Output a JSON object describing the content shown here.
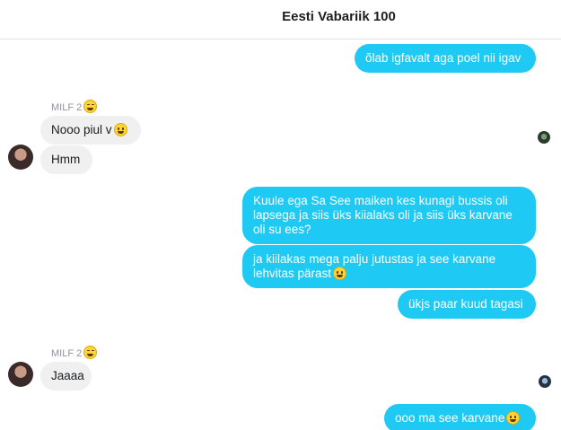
{
  "header": {
    "title": "Eesti Vabariik 100"
  },
  "messages": {
    "m1": "õlab igfavalt aga poel nii igav",
    "sender1": "MILF 2",
    "m2": "Nooo piul v",
    "m3": "Hmm",
    "m4": "Kuule ega Sa See maiken kes kunagi bussis oli lapsega ja siis üks kiialaks oli ja siis üks karvane oli su ees?",
    "m5": "ja kiilakas mega palju jutustas ja see karvane lehvitas pärast",
    "m6": "ükjs paar kuud tagasi",
    "sender2": "MILF 2",
    "m7": "Jaaaa",
    "m8": "ooo ma see karvane"
  },
  "icons": {
    "sender_emoji": "face-with-tears-of-joy-icon",
    "message_emoji": "grinning-face-icon",
    "avatar": "contact-avatar",
    "read_receipt": "read-receipt-avatar"
  }
}
